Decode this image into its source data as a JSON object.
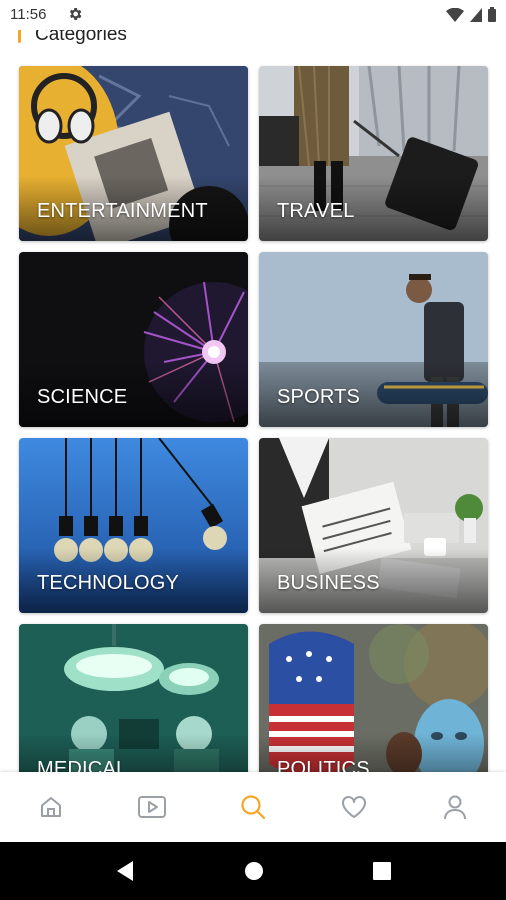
{
  "status_bar": {
    "time": "11:56"
  },
  "section": {
    "title": "Categories"
  },
  "categories": [
    {
      "label": "ENTERTAINMENT"
    },
    {
      "label": "TRAVEL"
    },
    {
      "label": "SCIENCE"
    },
    {
      "label": "SPORTS"
    },
    {
      "label": "TECHNOLOGY"
    },
    {
      "label": "BUSINESS"
    },
    {
      "label": "MEDICAL"
    },
    {
      "label": "POLITICS"
    }
  ],
  "bottom_nav": {
    "items": [
      {
        "icon": "home-icon"
      },
      {
        "icon": "video-icon"
      },
      {
        "icon": "search-icon",
        "active": true
      },
      {
        "icon": "heart-icon"
      },
      {
        "icon": "profile-icon"
      }
    ],
    "active_color": "#f5a623",
    "inactive_color": "#9aa0a6"
  }
}
